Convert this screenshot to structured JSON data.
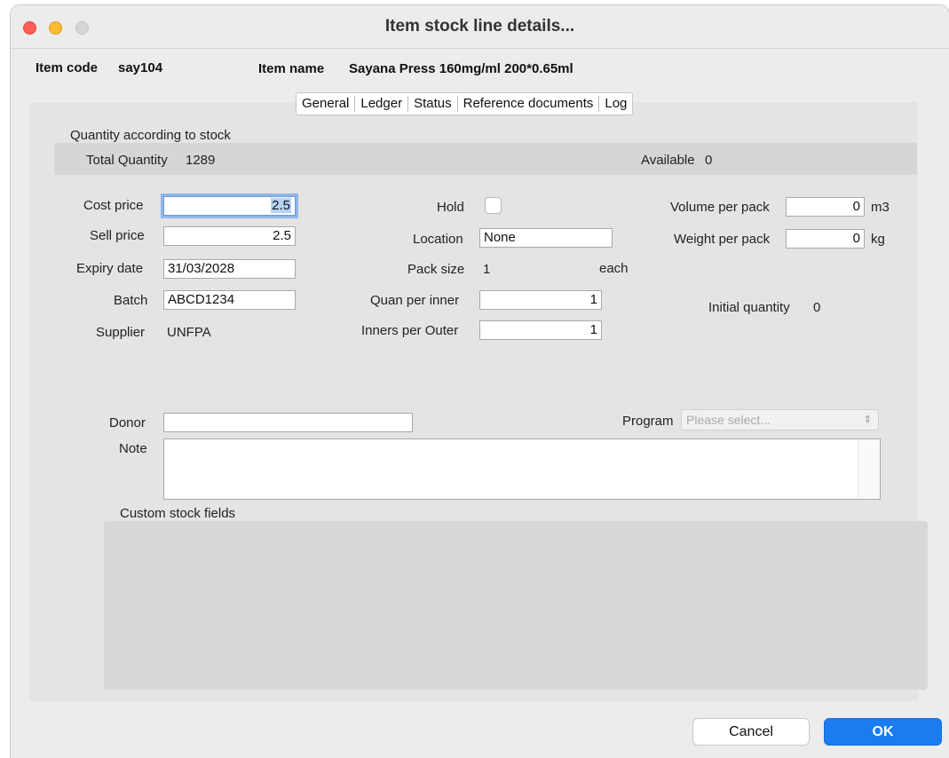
{
  "window": {
    "title": "Item stock line details..."
  },
  "header": {
    "item_code_label": "Item code",
    "item_code_value": "say104",
    "item_name_label": "Item name",
    "item_name_value": "Sayana Press 160mg/ml 200*0.65ml"
  },
  "tabs": [
    "General",
    "Ledger",
    "Status",
    "Reference documents",
    "Log"
  ],
  "quantity": {
    "section_label": "Quantity according to stock",
    "total_label": "Total Quantity",
    "total_value": "1289",
    "available_label": "Available",
    "available_value": "0"
  },
  "fields": {
    "cost_price_label": "Cost price",
    "cost_price_value": "2.5",
    "sell_price_label": "Sell price",
    "sell_price_value": "2.5",
    "expiry_label": "Expiry date",
    "expiry_value": "31/03/2028",
    "batch_label": "Batch",
    "batch_value": "ABCD1234",
    "supplier_label": "Supplier",
    "supplier_value": "UNFPA",
    "hold_label": "Hold",
    "location_label": "Location",
    "location_value": "None",
    "pack_size_label": "Pack size",
    "pack_size_value": "1",
    "pack_unit": "each",
    "quan_per_inner_label": "Quan per inner",
    "quan_per_inner_value": "1",
    "inners_per_outer_label": "Inners per Outer",
    "inners_per_outer_value": "1",
    "volume_label": "Volume per pack",
    "volume_value": "0",
    "volume_unit": "m3",
    "weight_label": "Weight per pack",
    "weight_value": "0",
    "weight_unit": "kg",
    "initial_qty_label": "Initial quantity",
    "initial_qty_value": "0",
    "donor_label": "Donor",
    "donor_value": "",
    "program_label": "Program",
    "program_placeholder": "Please select...",
    "note_label": "Note",
    "custom_fields_label": "Custom stock fields"
  },
  "buttons": {
    "cancel": "Cancel",
    "ok": "OK"
  },
  "colors": {
    "ok_button": "#1a7cf0",
    "focus_ring": "#8fb6ea",
    "close": "#ff5f57",
    "minimize": "#febc2e"
  }
}
